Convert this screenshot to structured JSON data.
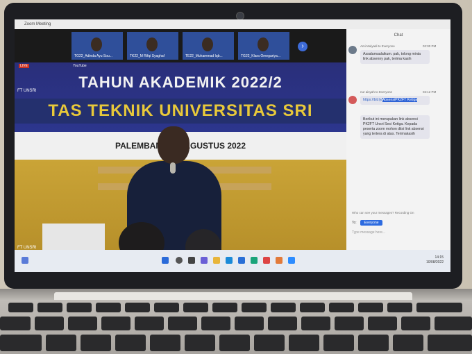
{
  "app": {
    "title": "Zoom Meeting"
  },
  "participants": [
    {
      "label": "TG22_Adinda Ayu Sou..."
    },
    {
      "label": "TK22_M Rifqi Syaghaf"
    },
    {
      "label": "TE22_Muhammad Iqb..."
    },
    {
      "label": "TG22_Klara Omegariya..."
    }
  ],
  "stream": {
    "live_badge": "LIVE",
    "youtube_label": "YouTube",
    "ft_label": "FT UNSRI",
    "ft_corner_label": "FT UNSRI",
    "banner_line1": "TAHUN AKADEMIK 2022/2",
    "banner_line2": "TAS TEKNIK UNIVERSITAS SRI",
    "banner_line3": "PALEMBANG, 10 AGUSTUS 2022"
  },
  "chat": {
    "title": "Chat",
    "messages": [
      {
        "sender": "Ami Mulyadi to Everyone",
        "time": "02:00 PM",
        "text": "Assalamualaikum. pak, tolong minta link absenny pak, terima kasih"
      },
      {
        "sender": "nur aisyah to Everyone",
        "time": "02:12 PM",
        "link": "https://bit.ly/",
        "link_highlight": "AbsensiPK2FT Ketiga",
        "text": "Berikut ini merupakan link absensi PK2FT Unsri Sesi Ketiga. Kepada peserta zoom mohon diisi link absensi yang tertera di atas. Terimakasih"
      }
    ],
    "who_can_see": "Who can see your messages? Recording On",
    "to_label": "To:",
    "recipient": "Everyone",
    "input_placeholder": "Type message here..."
  },
  "taskbar": {
    "time": "14:15",
    "date": "10/08/2022"
  },
  "colors": {
    "zoom_blue": "#2d6be0",
    "banner_yellow": "#e8c93a",
    "stage_blue": "#2d3a9a"
  }
}
